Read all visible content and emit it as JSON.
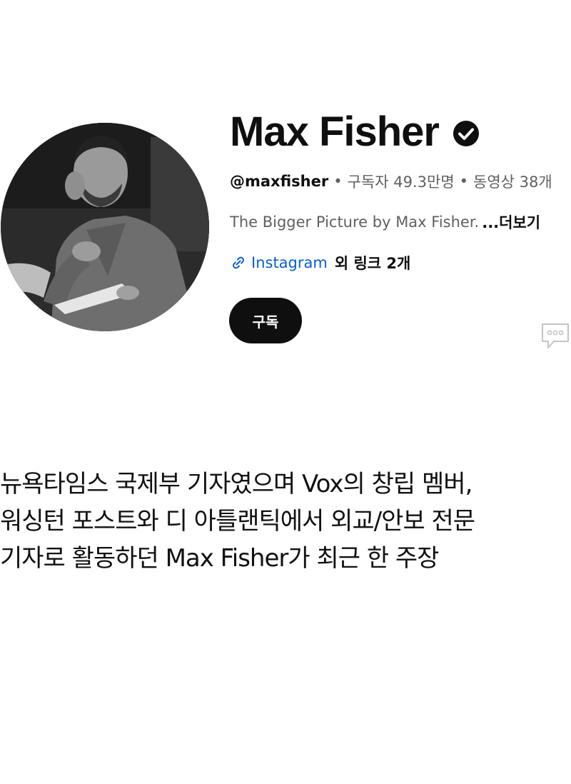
{
  "channel": {
    "name": "Max Fisher",
    "handle": "@maxfisher",
    "subscribers": "구독자 49.3만명",
    "videos": "동영상 38개",
    "separator": "•",
    "description": "The Bigger Picture by Max Fisher.",
    "more_label": "...더보기",
    "link_label": "Instagram",
    "extra_links": "외 링크 2개",
    "subscribe_label": "구독"
  },
  "icons": {
    "verified": "verified-check-icon",
    "link": "link-icon",
    "comment": "comment-bubble-icon"
  },
  "caption": {
    "line1": "뉴욕타임스 국제부 기자였으며 Vox의 창립 멤버,",
    "line2": "워싱턴 포스트와 디 아틀랜틱에서 외교/안보 전문",
    "line3": "기자로 활동하던 Max Fisher가 최근 한 주장"
  },
  "colors": {
    "text_primary": "#0f0f0f",
    "text_secondary": "#606060",
    "link": "#065fd4",
    "button_bg": "#0f0f0f",
    "button_text": "#ffffff"
  }
}
